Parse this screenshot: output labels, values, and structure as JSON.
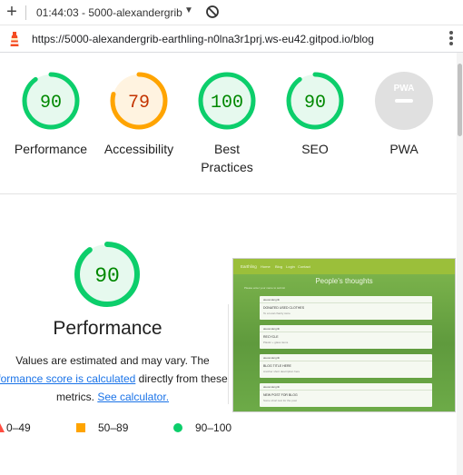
{
  "browser": {
    "tab_title": "01:44:03 - 5000-alexandergrib",
    "url": "https://5000-alexandergrib-earthling-n0lna3r1prj.ws-eu42.gitpod.io/blog"
  },
  "gauges": [
    {
      "label": "Performance",
      "score": "90",
      "status": "pass"
    },
    {
      "label": "Accessibility",
      "score": "79",
      "status": "average"
    },
    {
      "label": "Best Practices",
      "score": "100",
      "status": "pass"
    },
    {
      "label": "SEO",
      "score": "90",
      "status": "pass"
    },
    {
      "label": "PWA",
      "score": "",
      "status": "na"
    }
  ],
  "pwa_badge_text": "PWA",
  "performance": {
    "score": "90",
    "title": "Performance",
    "desc_line1": "Values are estimated and may vary. The",
    "desc_link1": "formance score is calculated",
    "desc_mid": " directly from these",
    "desc_line3_prefix": "metrics. ",
    "desc_link2": "See calculator."
  },
  "legend": {
    "fail": "0–49",
    "average": "50–89",
    "pass": "90–100"
  },
  "thumbnail": {
    "nav_brand": "Earthling",
    "nav_items": [
      "Home",
      "Blog",
      "Login",
      "Contact"
    ],
    "heading": "People's thoughts",
    "label": "Please enter your name to submit",
    "cards": [
      {
        "user": "alexandergrib",
        "title": "DONATED USED CLOTHES",
        "sub": "To a local charity store"
      },
      {
        "user": "alexandergrib",
        "title": "RECYCLE",
        "sub": "Plastic + glass items"
      },
      {
        "user": "alexandergrib",
        "title": "BLOG TITLE HERE",
        "sub": "Another short description here"
      },
      {
        "user": "alexandergrib",
        "title": "NEW POST FOR BLOG",
        "sub": "Some short text for the post"
      }
    ]
  },
  "colors": {
    "pass": "#0cce6b",
    "pass_text": "#008800",
    "pass_bg": "#e6f9ee",
    "average": "#ffa400",
    "average_text": "#c33300",
    "average_bg": "#fff3e0",
    "fail": "#ff4e42",
    "na_bg": "#e0e0e0",
    "link": "#1a73e8"
  }
}
